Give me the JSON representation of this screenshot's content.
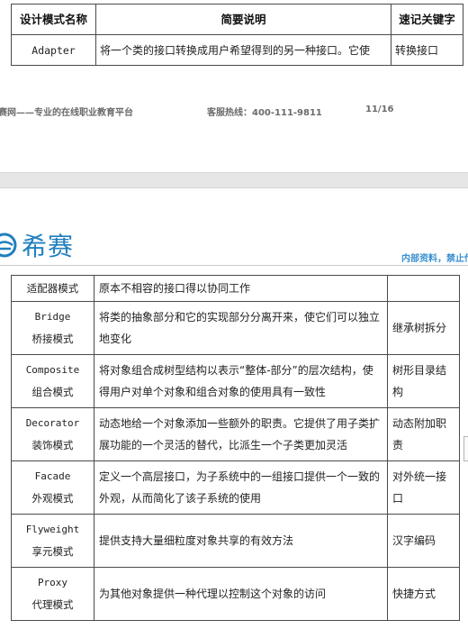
{
  "top_table": {
    "headers": [
      "设计模式名称",
      "简要说明",
      "速记关键字"
    ],
    "row": [
      "Adapter",
      "将一个类的接口转换成用户希望得到的另一种接口。它使",
      "转换接口"
    ]
  },
  "page_footer": {
    "site": "赛网——专业的在线职业教育平台",
    "hotline": "客服热线：400-111-9811",
    "page": "11/16"
  },
  "page_header": {
    "logo_text": "希赛",
    "notice": "内部资料，禁止传"
  },
  "patterns": [
    {
      "en": "",
      "zh": "适配器模式",
      "desc": "原本不相容的接口得以协同工作",
      "keyword": ""
    },
    {
      "en": "Bridge",
      "zh": "桥接模式",
      "desc": "将类的抽象部分和它的实现部分分离开来，使它们可以独立地变化",
      "keyword": "继承树拆分"
    },
    {
      "en": "Composite",
      "zh": "组合模式",
      "desc": "将对象组合成树型结构以表示“整体-部分”的层次结构，使得用户对单个对象和组合对象的使用具有一致性",
      "keyword": "树形目录结构"
    },
    {
      "en": "Decorator",
      "zh": "装饰模式",
      "desc": "动态地给一个对象添加一些额外的职责。它提供了用子类扩展功能的一个灵活的替代，比派生一个子类更加灵活",
      "keyword": "动态附加职责"
    },
    {
      "en": "Facade",
      "zh": "外观模式",
      "desc": "定义一个高层接口，为子系统中的一组接口提供一个一致的外观，从而简化了该子系统的使用",
      "keyword": "对外统一接口"
    },
    {
      "en": "Flyweight",
      "zh": "享元模式",
      "desc": "提供支持大量细粒度对象共享的有效方法",
      "keyword": "汉字编码"
    },
    {
      "en": "Proxy",
      "zh": "代理模式",
      "desc": "为其他对象提供一种代理以控制这个对象的访问",
      "keyword": "快捷方式"
    }
  ],
  "colors": {
    "brand": "#1f7fc0",
    "notice": "#3a8fcf"
  }
}
